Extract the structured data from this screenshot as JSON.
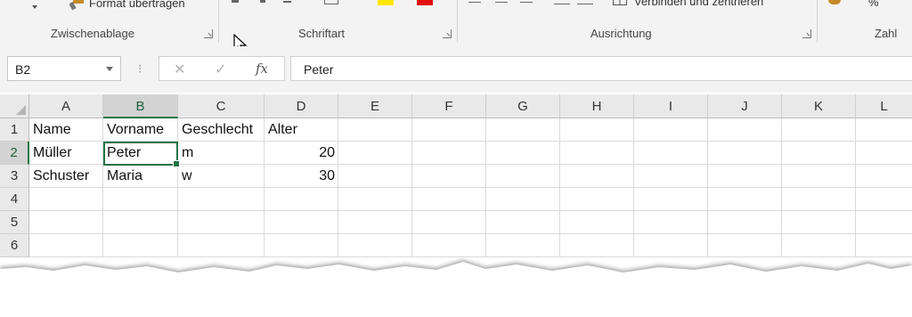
{
  "ribbon": {
    "clipboard": {
      "format_painter_label": "Format übertragen",
      "group_label": "Zwischenablage"
    },
    "font": {
      "group_label": "Schriftart"
    },
    "alignment": {
      "merge_label": "Verbinden und zentrieren",
      "group_label": "Ausrichtung"
    },
    "number": {
      "group_label": "Zahl",
      "percent_symbol": "%"
    }
  },
  "formula_bar": {
    "name_box": "B2",
    "separator": "⁝",
    "cancel_glyph": "✕",
    "enter_glyph": "✓",
    "fx_glyph": "fx",
    "value": "Peter"
  },
  "sheet": {
    "columns": [
      "A",
      "B",
      "C",
      "D",
      "E",
      "F",
      "G",
      "H",
      "I",
      "J",
      "K",
      "L"
    ],
    "rows": [
      "1",
      "2",
      "3",
      "4",
      "5",
      "6"
    ],
    "selected_cell": "B2",
    "cells": {
      "A1": "Name",
      "B1": "Vorname",
      "C1": "Geschlecht",
      "D1": "Alter",
      "A2": "Müller",
      "B2": "Peter",
      "C2": "m",
      "D2": "20",
      "A3": "Schuster",
      "B3": "Maria",
      "C3": "w",
      "D3": "30"
    }
  },
  "colors": {
    "accent": "#217346",
    "ribbon_bg": "#f3f3f3",
    "header_bg": "#e9e9e9"
  },
  "icons": [
    "format-painter-icon",
    "fill-color-icon",
    "font-color-icon",
    "merge-center-icon",
    "dialog-launcher-icon",
    "mouse-pointer-icon"
  ]
}
